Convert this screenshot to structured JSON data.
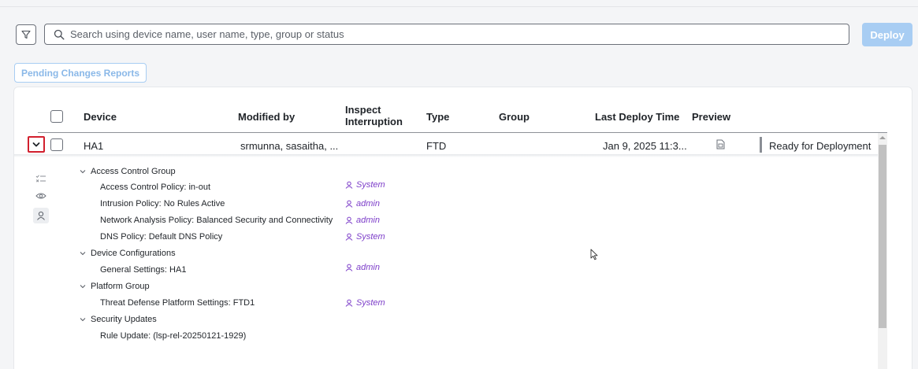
{
  "toolbar": {
    "filter_icon": "filter-icon",
    "search_icon": "search-icon",
    "search_placeholder": "Search using device name, user name, type, group or status",
    "search_value": "",
    "deploy_label": "Deploy",
    "pending_label": "Pending Changes Reports"
  },
  "table": {
    "headers": {
      "device": "Device",
      "modified_by": "Modified by",
      "inspect_line1": "Inspect",
      "inspect_line2": "Interruption",
      "type": "Type",
      "group": "Group",
      "last_deploy": "Last Deploy Time",
      "preview": "Preview"
    },
    "row": {
      "device": "HA1",
      "modified_by": "srmunna, sasaitha, ...",
      "type": "FTD",
      "group": "",
      "last_deploy": "Jan 9, 2025 11:3...",
      "status": "Ready for Deployment"
    }
  },
  "details": {
    "sidebar_icons": [
      "checklist-icon",
      "eye-icon",
      "user-icon"
    ],
    "groups": [
      {
        "label": "Access Control Group",
        "items": [
          {
            "label": "Access Control Policy: in-out",
            "user": "System"
          },
          {
            "label": "Intrusion Policy: No Rules Active",
            "user": "admin"
          },
          {
            "label": "Network Analysis Policy: Balanced Security and Connectivity",
            "user": "admin"
          },
          {
            "label": "DNS Policy: Default DNS Policy",
            "user": "System"
          }
        ]
      },
      {
        "label": "Device Configurations",
        "items": [
          {
            "label": "General Settings: HA1",
            "user": "admin"
          }
        ]
      },
      {
        "label": "Platform Group",
        "items": [
          {
            "label": "Threat Defense Platform Settings: FTD1",
            "user": "System"
          }
        ]
      },
      {
        "label": "Security Updates",
        "items": [
          {
            "label": "Rule Update: (lsp-rel-20250121-1929)",
            "user": ""
          }
        ]
      }
    ]
  },
  "colors": {
    "accent_disabled": "#a8cdf3",
    "user_link": "#7d3ec9",
    "highlight_border": "#d2202e"
  }
}
